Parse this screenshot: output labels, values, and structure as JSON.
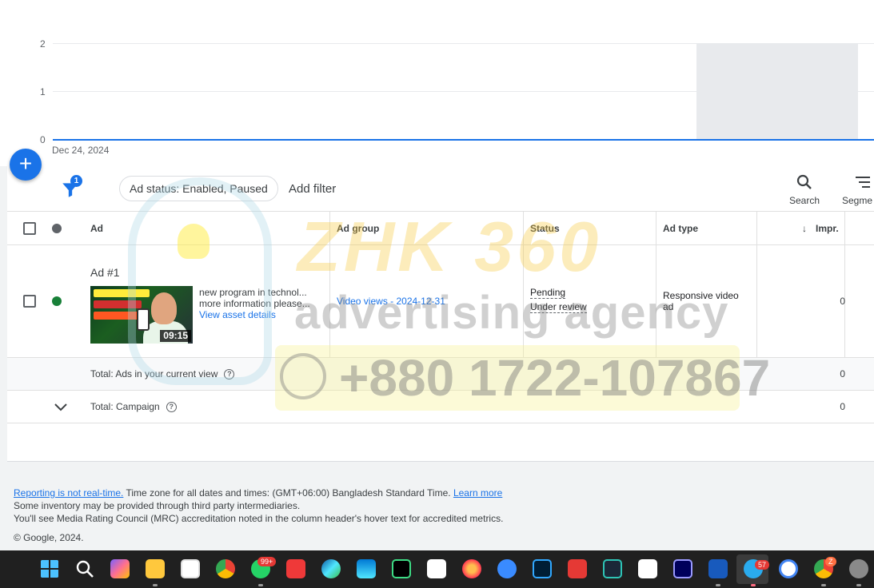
{
  "chart": {
    "y_ticks": [
      "2",
      "1",
      "0"
    ],
    "x_tick": "Dec 24, 2024"
  },
  "chart_data": {
    "type": "line",
    "x": [
      "Dec 24, 2024"
    ],
    "series": [
      {
        "values": [
          0
        ]
      }
    ],
    "ylim": [
      0,
      2
    ],
    "grid": true,
    "color": "#1a73e8"
  },
  "fab": {
    "label": "+"
  },
  "toolbar": {
    "filter_count": "1",
    "chip_label": "Ad status: Enabled, Paused",
    "add_filter": "Add filter",
    "search_label": "Search",
    "segment_label": "Segme"
  },
  "table": {
    "headers": {
      "ad": "Ad",
      "ad_group": "Ad group",
      "status": "Status",
      "ad_type": "Ad type",
      "impr": "Impr."
    },
    "row": {
      "ad_name": "Ad #1",
      "duration": "09:15",
      "desc_line1": "new program in technol...",
      "desc_line2": "more information please...",
      "view_asset": "View asset details",
      "ad_group": "Video views - 2024-12-31",
      "status_1": "Pending",
      "status_2": "Under review",
      "ad_type_1": "Responsive video",
      "ad_type_2": "ad",
      "impr": "0",
      "status_dot_color": "#188038"
    },
    "total_view": {
      "label": "Total: Ads in your current view",
      "impr": "0"
    },
    "total_campaign": {
      "label": "Total: Campaign",
      "impr": "0"
    }
  },
  "watermark": {
    "brand": "ZHK 360",
    "sub": "advertising agency",
    "phone": "+880 1722-107867"
  },
  "footer": {
    "reporting": "Reporting is not real-time.",
    "timezone": " Time zone for all dates and times: (GMT+06:00) Bangladesh Standard Time. ",
    "learn_more": "Learn more",
    "line2": "Some inventory may be provided through third party intermediaries.",
    "line3": "You'll see Media Rating Council (MRC) accreditation noted in the column header's hover text for accredited metrics.",
    "copyright": "© Google, 2024."
  },
  "taskbar": {
    "whatsapp_badge": "99+",
    "telegram_badge": "57",
    "chrome_badge": "Z"
  }
}
